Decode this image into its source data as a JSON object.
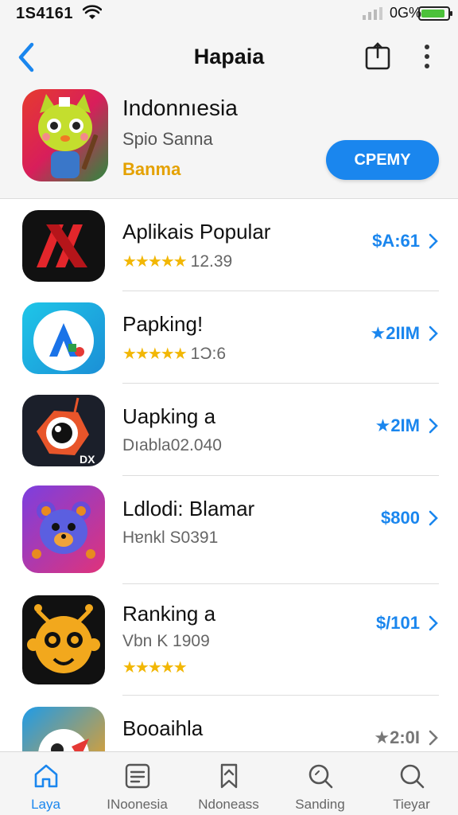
{
  "status": {
    "time": "1S4161",
    "battery_text": "0G%",
    "battery_level": 0.9
  },
  "nav": {
    "title": "Hapaia"
  },
  "featured": {
    "title": "Indonnıesia",
    "subtitle": "Spio Sanna",
    "category": "Banma",
    "button_label": "CPEMY"
  },
  "list": [
    {
      "title": "Aplikais Popular",
      "stars": "★★★★★",
      "sub": "12.39",
      "price": "$A:61",
      "icon": "red-x-app-icon"
    },
    {
      "title": "Papking!",
      "stars": "★★★★★",
      "sub": "1Ɔ:6",
      "price": "★2IIM",
      "icon": "blue-arrow-app-icon"
    },
    {
      "title": "Uapking a",
      "stars": "",
      "sub": "Dıabla02.040",
      "price": "★2IM",
      "icon": "camera-creature-app-icon"
    },
    {
      "title": "Ldlodi: Blamar",
      "stars": "",
      "sub": "Hɐnkl S0391",
      "price": "$800",
      "icon": "bear-app-icon"
    },
    {
      "title": "Ranking a",
      "stars": "",
      "sub": "Vbn K 1909",
      "price": "$/101",
      "icon": "monkey-app-icon",
      "extra_stars": "★★★★★"
    },
    {
      "title": "Booaihla",
      "stars": "",
      "sub": "",
      "price": "★2:0I",
      "icon": "bird-app-icon"
    }
  ],
  "tabs": [
    {
      "label": "Laya",
      "icon": "home-icon"
    },
    {
      "label": "INoonesia",
      "icon": "list-icon"
    },
    {
      "label": "Ndoneass",
      "icon": "bookmark-icon"
    },
    {
      "label": "Sanding",
      "icon": "search-icon"
    },
    {
      "label": "Tieyar",
      "icon": "search-icon"
    }
  ],
  "colors": {
    "accent": "#1a86ee",
    "gold": "#e4a100",
    "star": "#f2b705"
  }
}
